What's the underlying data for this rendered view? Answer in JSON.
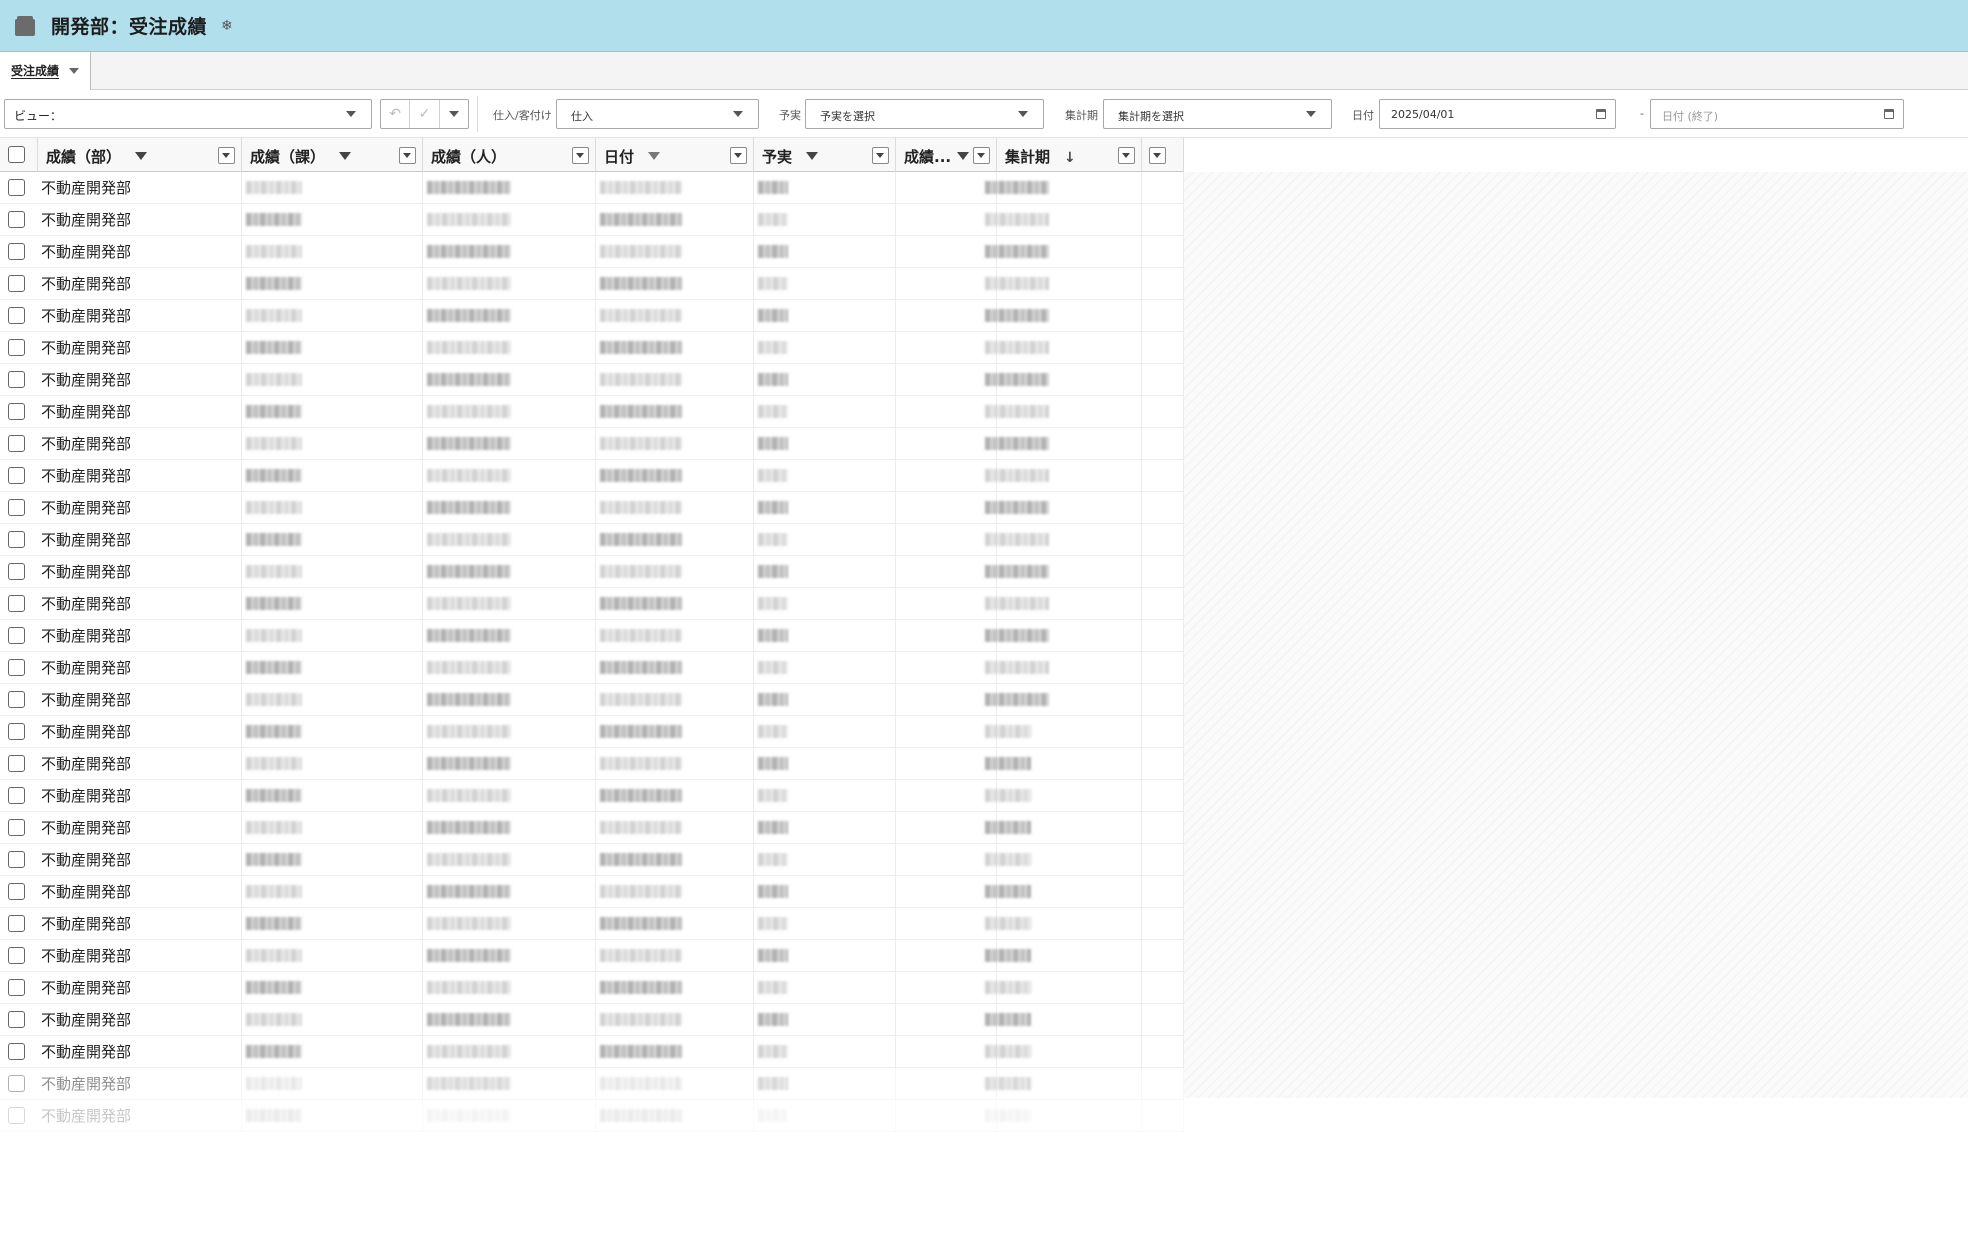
{
  "header": {
    "title": "開発部：受注成績",
    "folder_icon": "folder-icon",
    "settings_icon": "gear-icon"
  },
  "tabs": [
    {
      "label": "受注成績",
      "active": true
    }
  ],
  "toolbar": {
    "view_label": "ビュー：",
    "undo_icon": "undo-icon",
    "save_icon": "check-icon",
    "purchase_label": "仕入/客付け",
    "purchase_value": "仕入",
    "plan_label": "予実",
    "plan_value": "予実を選択",
    "period_label": "集計期",
    "period_value": "集計期を選択",
    "date_label": "日付",
    "date_from": "2025/04/01",
    "date_to_placeholder": "日付 (終了)",
    "range_separator": "-"
  },
  "columns": [
    {
      "label": "成績（部）",
      "filter": "filter-icon"
    },
    {
      "label": "成績（課）",
      "filter": "filter-icon"
    },
    {
      "label": "成績（人）",
      "filter": ""
    },
    {
      "label": "日付",
      "filter": "filter-outline-icon"
    },
    {
      "label": "予実",
      "filter": "filter-icon"
    },
    {
      "label": "成績...",
      "filter": "filter-icon"
    },
    {
      "label": "集計期",
      "sort": "sort-descending-icon"
    }
  ],
  "rows": {
    "department": "不動産開発部",
    "count": 30
  }
}
